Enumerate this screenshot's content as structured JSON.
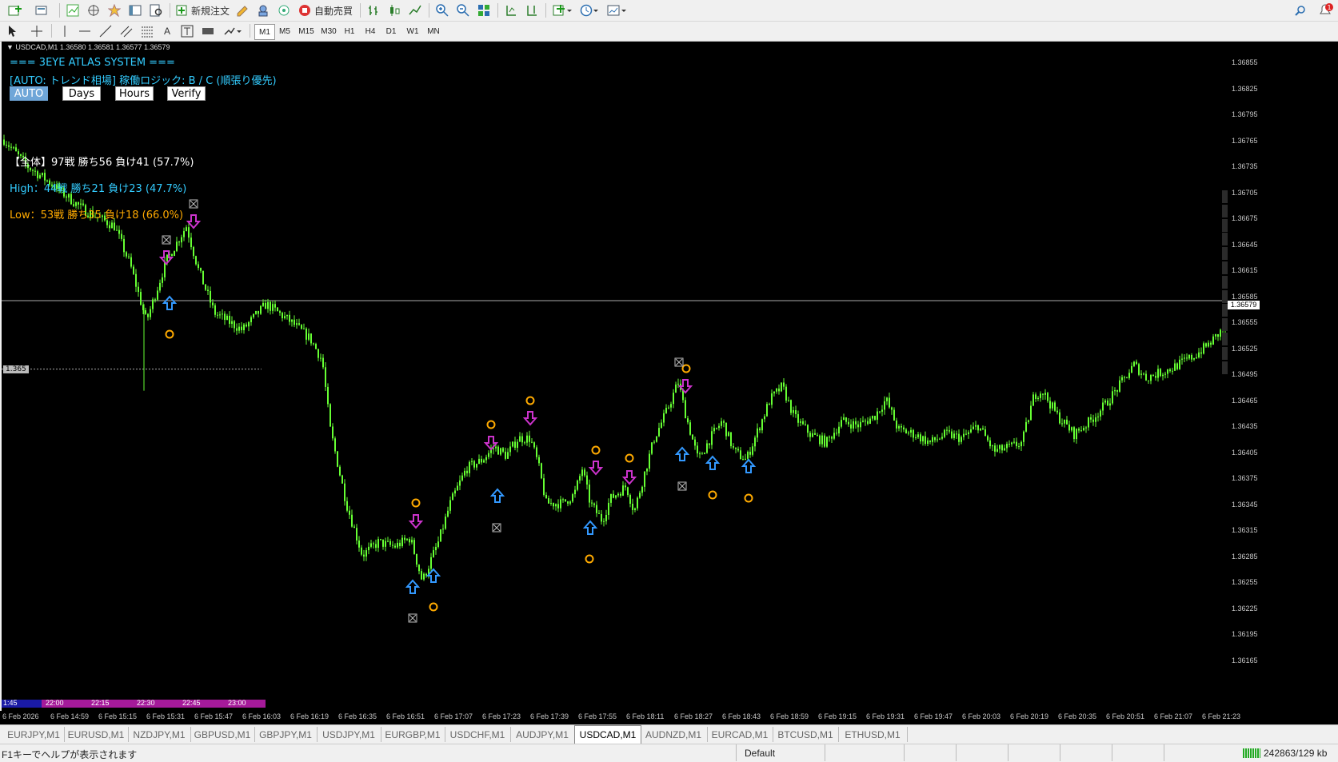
{
  "toolbar": {
    "new_order": "新規注文",
    "auto_trading": "自動売買",
    "timeframes": [
      "M1",
      "M5",
      "M15",
      "M30",
      "H1",
      "H4",
      "D1",
      "W1",
      "MN"
    ]
  },
  "chart": {
    "header": "USDCAD,M1  1.36580 1.36581 1.36577 1.36579",
    "system_title": "=== 3EYE ATLAS SYSTEM ===",
    "mode_line": "[AUTO: トレンド相場] 稼働ロジック: B / C (順張り優先)",
    "buttons": [
      "AUTO",
      "Days",
      "Hours",
      "Verify"
    ],
    "stats_all": "【全体】97戦 勝ち56 負け41 (57.7%)",
    "stats_high": "High：44戦 勝ち21 負け23 (47.7%)",
    "stats_low": "Low：53戦 勝ち35 負け18 (66.0%)",
    "hline_label": "1.365",
    "current_price": "1.36579",
    "symbols": [
      "EURJPY",
      "EURUSD",
      "NZDJPY",
      "GBPUSD",
      "GBPJPY",
      "USDJPY",
      "EURGBP",
      "USDCHF",
      "AUDJPY",
      "USDCAD",
      "AUDNZD",
      "EURCAD",
      "BTCUSD"
    ],
    "active_symbol": "USDCAD",
    "tf_buttons": [
      "MN",
      "W1",
      "D1",
      "H4",
      "H1",
      "30",
      "15",
      "M5",
      "M1"
    ],
    "active_tf": "M1",
    "price_axis": [
      "1.36855",
      "1.36825",
      "1.36795",
      "1.36765",
      "1.36735",
      "1.36705",
      "1.36675",
      "1.36645",
      "1.36615",
      "1.36585",
      "1.36555",
      "1.36525",
      "1.36495",
      "1.36465",
      "1.36435",
      "1.36405",
      "1.36375",
      "1.36345",
      "1.36315",
      "1.36285",
      "1.36255",
      "1.36225",
      "1.36195",
      "1.36165"
    ],
    "time_axis": [
      "6 Feb 2026",
      "6 Feb 14:59",
      "6 Feb 15:15",
      "6 Feb 15:31",
      "6 Feb 15:47",
      "6 Feb 16:03",
      "6 Feb 16:19",
      "6 Feb 16:35",
      "6 Feb 16:51",
      "6 Feb 17:07",
      "6 Feb 17:23",
      "6 Feb 17:39",
      "6 Feb 17:55",
      "6 Feb 18:11",
      "6 Feb 18:27",
      "6 Feb 18:43",
      "6 Feb 18:59",
      "6 Feb 19:15",
      "6 Feb 19:31",
      "6 Feb 19:47",
      "6 Feb 20:03",
      "6 Feb 20:19",
      "6 Feb 20:35",
      "6 Feb 20:51",
      "6 Feb 21:07",
      "6 Feb 21:23"
    ],
    "session_bar": [
      "1:45",
      "22:00",
      "22:15",
      "22:30",
      "22:45",
      "23:00"
    ],
    "colors": {
      "bull": "#66ff33",
      "down_arrow": "#cc33cc",
      "up_arrow": "#3399ff",
      "circle": "#ffaa00",
      "active_red": "#ff3333"
    }
  },
  "tabs": [
    "EURJPY,M1",
    "EURUSD,M1",
    "NZDJPY,M1",
    "GBPUSD,M1",
    "GBPJPY,M1",
    "USDJPY,M1",
    "EURGBP,M1",
    "USDCHF,M1",
    "AUDJPY,M1",
    "USDCAD,M1",
    "AUDNZD,M1",
    "EURCAD,M1",
    "BTCUSD,M1",
    "ETHUSD,M1"
  ],
  "active_tab": "USDCAD,M1",
  "status": {
    "help": "F1キーでヘルプが表示されます",
    "profile": "Default",
    "traffic": "242863/129 kb"
  }
}
